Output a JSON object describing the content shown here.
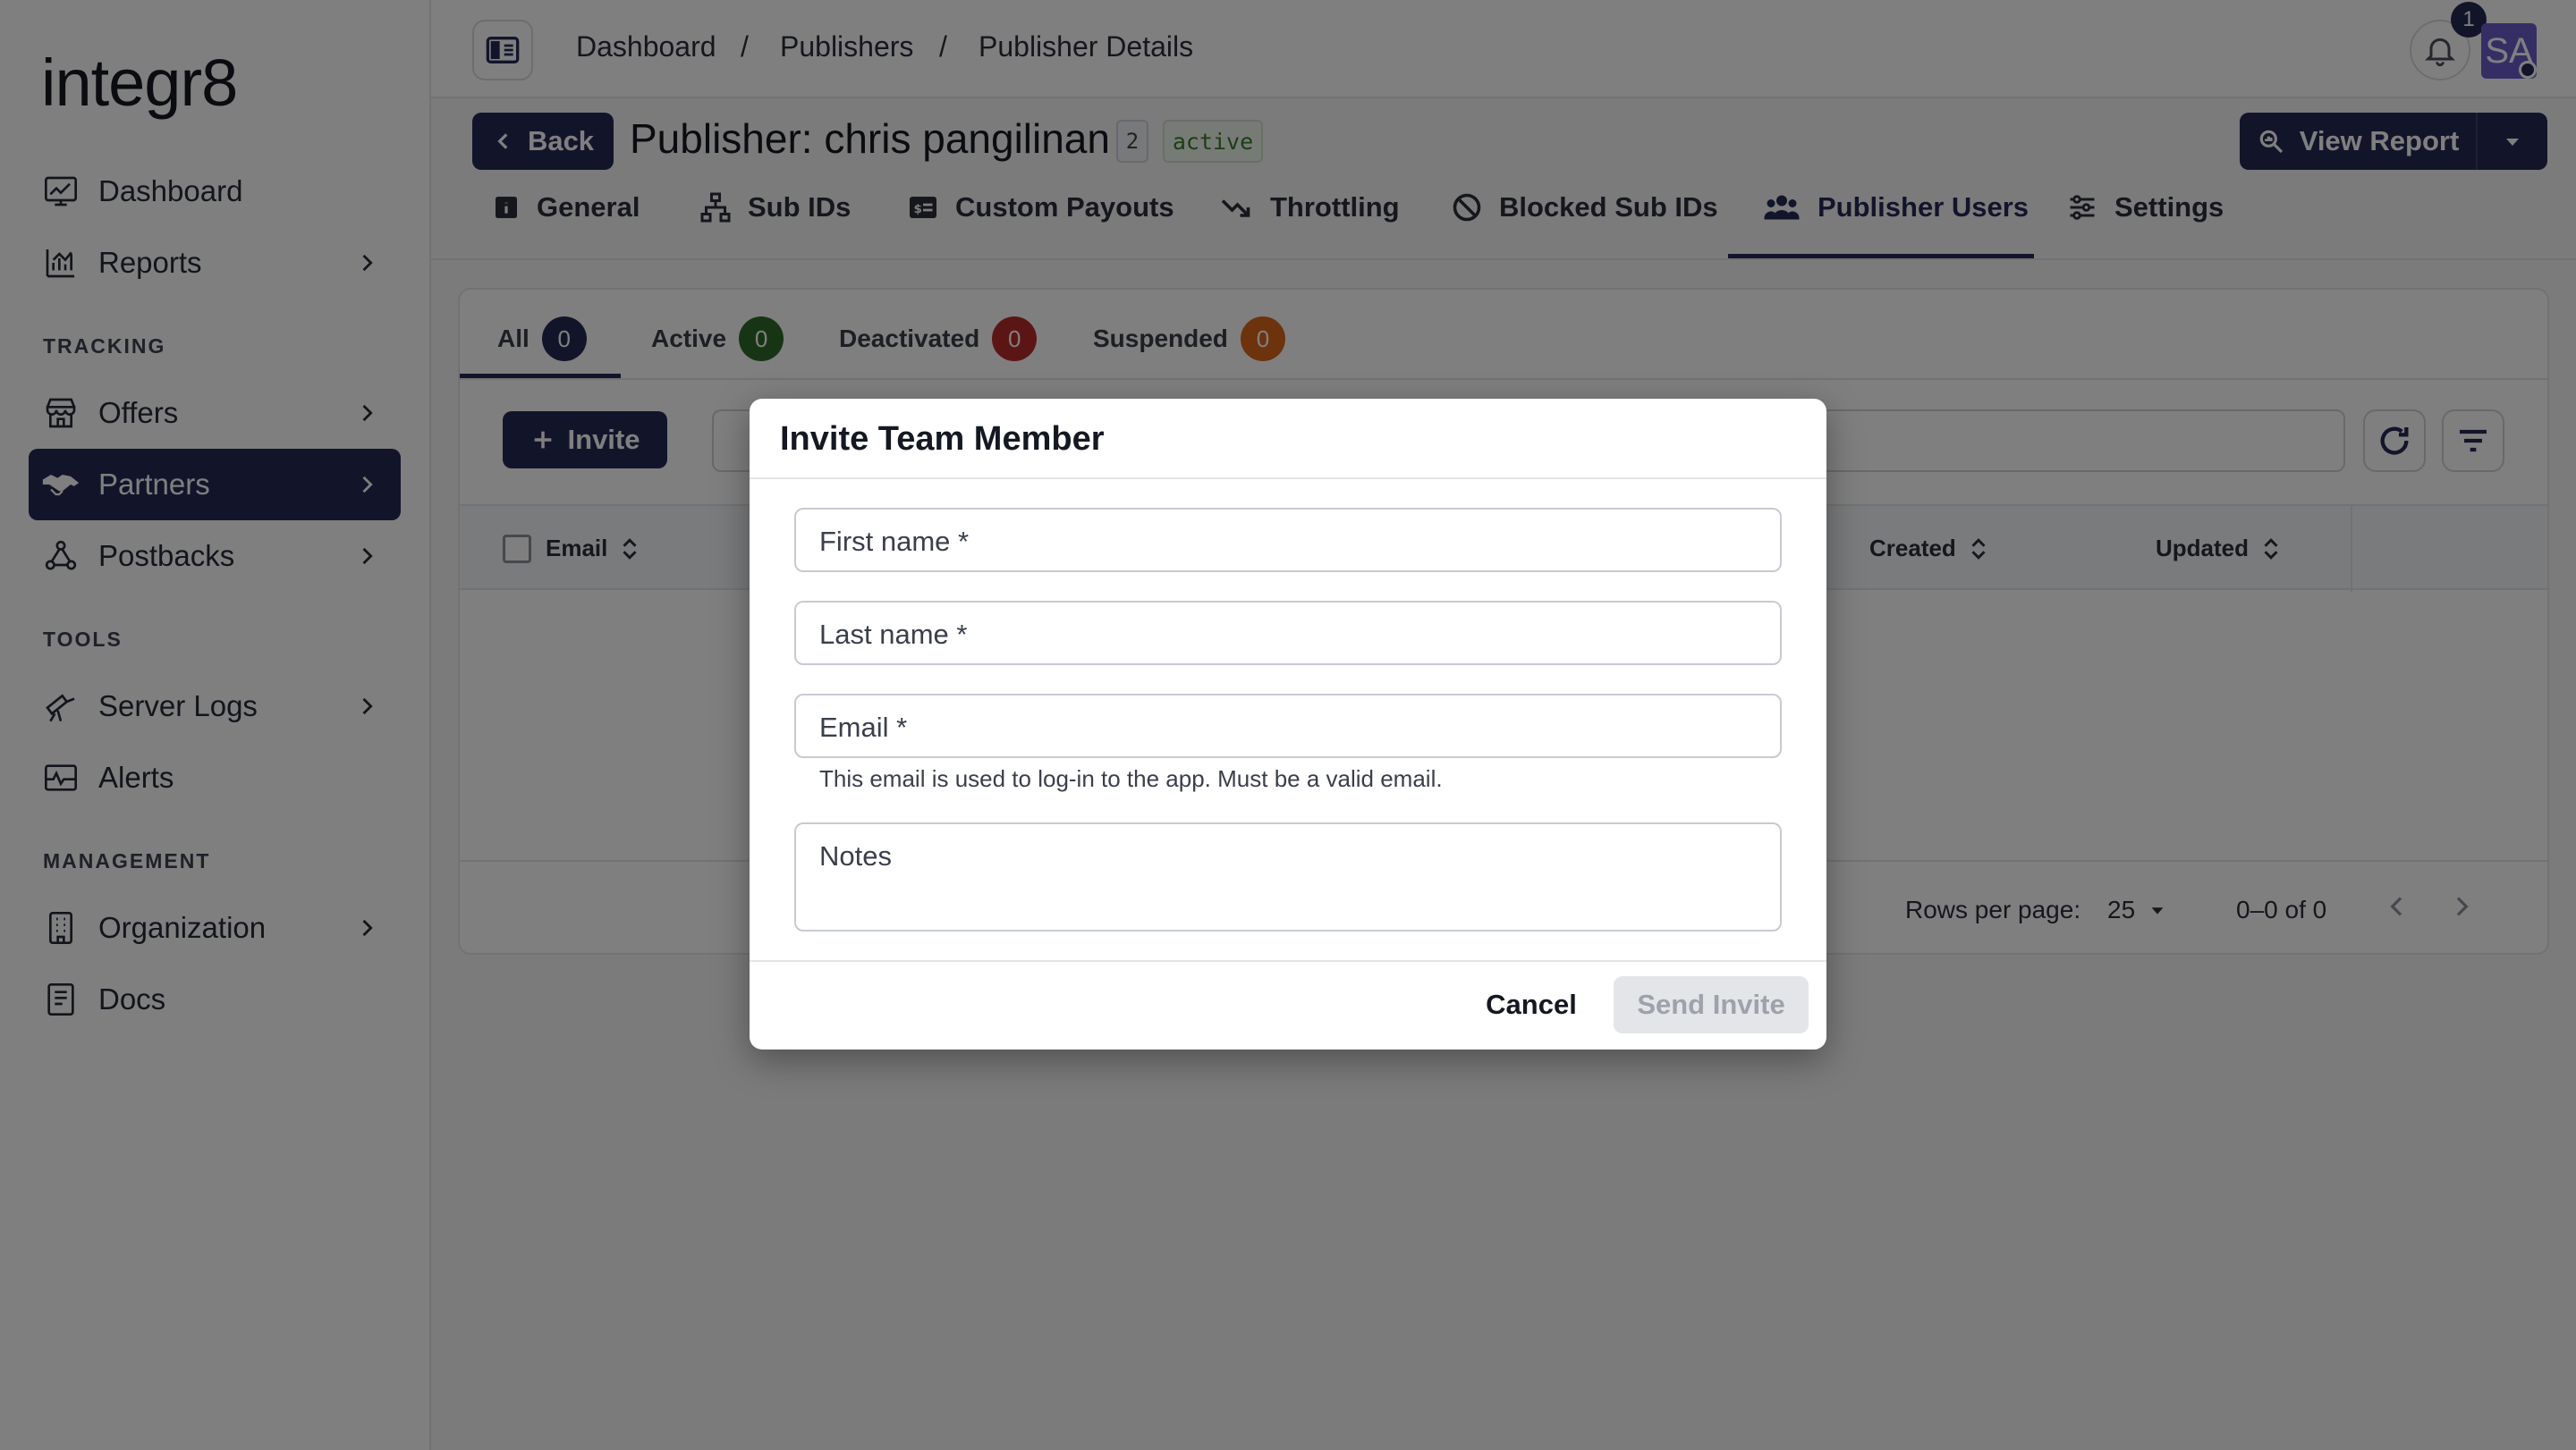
{
  "app": {
    "logo": "integr8"
  },
  "sidebar": {
    "items": [
      {
        "label": "Dashboard",
        "icon": "dashboard-icon"
      },
      {
        "label": "Reports",
        "icon": "reports-icon"
      },
      {
        "label": "Offers",
        "icon": "offers-icon"
      },
      {
        "label": "Partners",
        "icon": "partners-icon"
      },
      {
        "label": "Postbacks",
        "icon": "postbacks-icon"
      },
      {
        "label": "Server Logs",
        "icon": "server-logs-icon"
      },
      {
        "label": "Alerts",
        "icon": "alerts-icon"
      },
      {
        "label": "Organization",
        "icon": "organization-icon"
      },
      {
        "label": "Docs",
        "icon": "docs-icon"
      }
    ],
    "sections": {
      "tracking": "TRACKING",
      "tools": "TOOLS",
      "management": "MANAGEMENT"
    }
  },
  "breadcrumb": {
    "items": [
      "Dashboard",
      "Publishers",
      "Publisher Details"
    ],
    "separator": "/"
  },
  "topbar": {
    "notification_count": "1",
    "avatar_initials": "SA"
  },
  "header": {
    "back_label": "Back",
    "title": "Publisher: chris pangilinan",
    "id_chip": "2",
    "status_chip": "active",
    "view_report_label": "View Report"
  },
  "tabs": [
    {
      "label": "General"
    },
    {
      "label": "Sub IDs"
    },
    {
      "label": "Custom Payouts"
    },
    {
      "label": "Throttling"
    },
    {
      "label": "Blocked Sub IDs"
    },
    {
      "label": "Publisher Users"
    },
    {
      "label": "Settings"
    }
  ],
  "active_tab": "Publisher Users",
  "subtabs": [
    {
      "label": "All",
      "count": "0",
      "color": "#242a55"
    },
    {
      "label": "Active",
      "count": "0",
      "color": "#2f6b2a"
    },
    {
      "label": "Deactivated",
      "count": "0",
      "color": "#b92a2a"
    },
    {
      "label": "Suspended",
      "count": "0",
      "color": "#d8661a"
    }
  ],
  "toolbar": {
    "invite_label": "Invite"
  },
  "table": {
    "columns": [
      "Email",
      "Created",
      "Updated"
    ]
  },
  "pagination": {
    "rows_label": "Rows per page:",
    "rows_value": "25",
    "range": "0–0 of 0"
  },
  "dialog": {
    "title": "Invite Team Member",
    "first_name_label": "First name *",
    "last_name_label": "Last name *",
    "email_label": "Email *",
    "email_helper": "This email is used to log-in to the app. Must be a valid email.",
    "notes_label": "Notes",
    "cancel_label": "Cancel",
    "send_label": "Send Invite"
  },
  "colors": {
    "primary": "#242a55",
    "accent_avatar": "#6b5cc8"
  }
}
